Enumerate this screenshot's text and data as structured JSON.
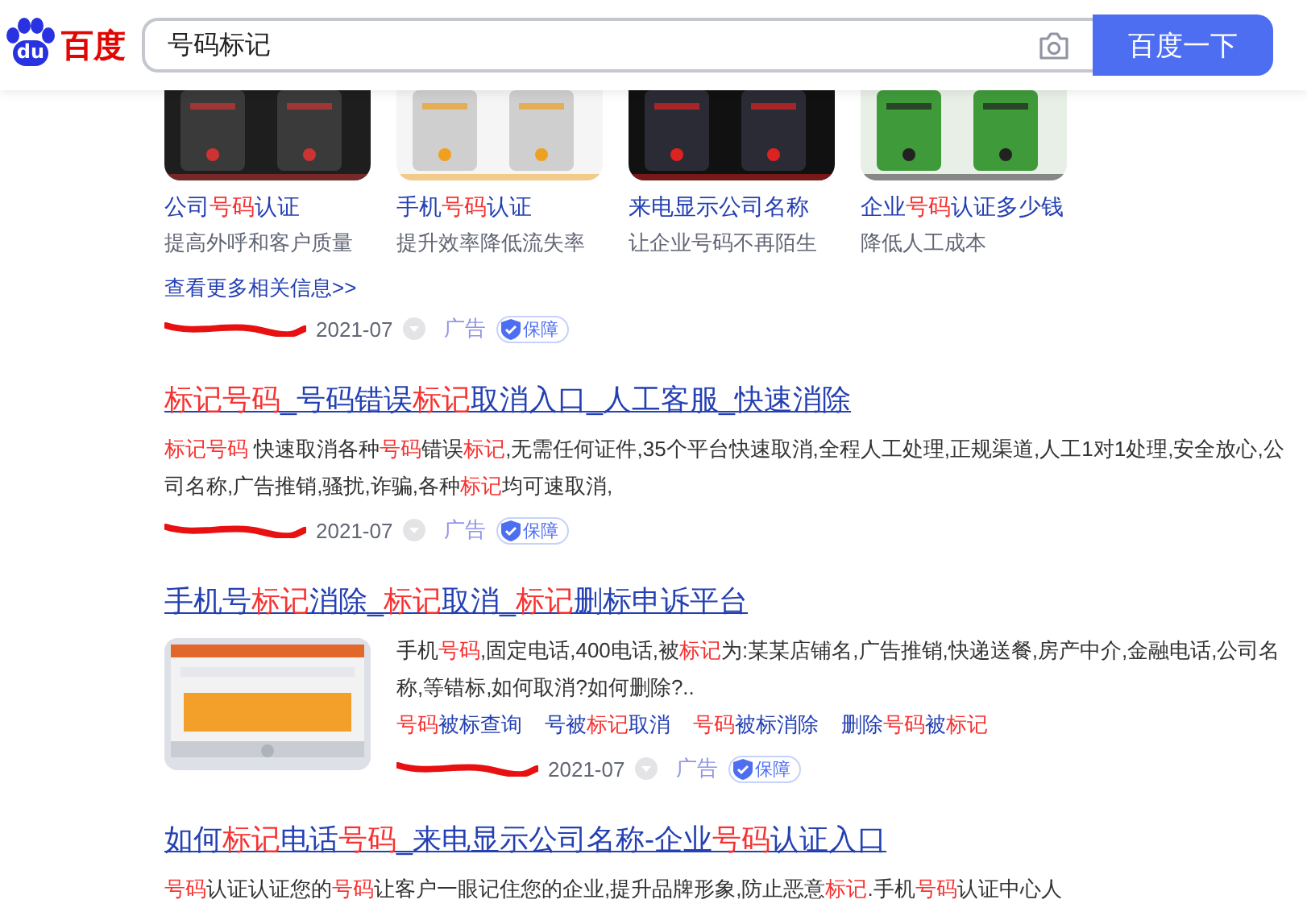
{
  "header": {
    "logo_mark": "du",
    "logo_text": "百度",
    "search": {
      "value": "号码标记",
      "button": "百度一下"
    }
  },
  "ad_cards": {
    "cards": [
      {
        "title": [
          {
            "t": "公司"
          },
          {
            "t": "号码",
            "hit": true
          },
          {
            "t": "认证"
          }
        ],
        "subtitle": "提高外呼和客户质量",
        "picture": {
          "kind": "picture"
        }
      },
      {
        "title": [
          {
            "t": "手机"
          },
          {
            "t": "号码",
            "hit": true
          },
          {
            "t": "认证"
          }
        ],
        "subtitle": "提升效率降低流失率",
        "picture": {
          "kind": "picture"
        }
      },
      {
        "title": [
          {
            "t": "来电显示公司名称"
          }
        ],
        "subtitle": "让企业号码不再陌生",
        "picture": {
          "kind": "picture"
        }
      },
      {
        "title": [
          {
            "t": "企业"
          },
          {
            "t": "号码",
            "hit": true
          },
          {
            "t": "认证多少钱"
          }
        ],
        "subtitle": "降低人工成本",
        "picture": {
          "kind": "picture"
        }
      }
    ],
    "more_link": "查看更多相关信息>>",
    "source": {
      "date": "2021-07",
      "ad_label": "广告",
      "badge": "保障"
    }
  },
  "results": [
    {
      "title": [
        {
          "t": "标记号码",
          "hit": true
        },
        {
          "t": "_号码错误"
        },
        {
          "t": "标记",
          "hit": true
        },
        {
          "t": "取消入口_人工客服_快速消除"
        }
      ],
      "description": [
        {
          "t": "标记号码",
          "hit": true
        },
        {
          "t": " 快速取消各种"
        },
        {
          "t": "号码",
          "hit": true
        },
        {
          "t": "错误"
        },
        {
          "t": "标记",
          "hit": true
        },
        {
          "t": ",无需任何证件,35个平台快速取消,全程人工处理,正规渠道,人工1对1处理,安全放心,公司名称,广告推销,骚扰,诈骗,各种"
        },
        {
          "t": "标记",
          "hit": true
        },
        {
          "t": "均可速取消,"
        }
      ],
      "source": {
        "date": "2021-07",
        "ad_label": "广告",
        "badge": "保障"
      }
    },
    {
      "title": [
        {
          "t": "手机号"
        },
        {
          "t": "标记",
          "hit": true
        },
        {
          "t": "消除_"
        },
        {
          "t": "标记",
          "hit": true
        },
        {
          "t": "取消_"
        },
        {
          "t": "标记",
          "hit": true
        },
        {
          "t": "删标申诉平台"
        }
      ],
      "thumbnail": {
        "kind": "picture"
      },
      "description": [
        {
          "t": "手机"
        },
        {
          "t": "号码",
          "hit": true
        },
        {
          "t": ",固定电话,400电话,被"
        },
        {
          "t": "标记",
          "hit": true
        },
        {
          "t": "为:某某店铺名,广告推销,快递送餐,房产中介,金融电话,公司名称,等错标,如何取消?如何删除?.."
        }
      ],
      "sublinks": [
        [
          {
            "t": "号码",
            "hit": true
          },
          {
            "t": "被标查询"
          }
        ],
        [
          {
            "t": "号被"
          },
          {
            "t": "标记",
            "hit": true
          },
          {
            "t": "取消"
          }
        ],
        [
          {
            "t": "号码",
            "hit": true
          },
          {
            "t": "被标消除"
          }
        ],
        [
          {
            "t": "删除"
          },
          {
            "t": "号码",
            "hit": true
          },
          {
            "t": "被"
          },
          {
            "t": "标记",
            "hit": true
          }
        ]
      ],
      "source": {
        "date": "2021-07",
        "ad_label": "广告",
        "badge": "保障"
      }
    },
    {
      "title": [
        {
          "t": "如何"
        },
        {
          "t": "标记",
          "hit": true
        },
        {
          "t": "电话"
        },
        {
          "t": "号码",
          "hit": true
        },
        {
          "t": "_来电显示公司名称-企业"
        },
        {
          "t": "号码",
          "hit": true
        },
        {
          "t": "认证入口"
        }
      ],
      "description": [
        {
          "t": "号码",
          "hit": true
        },
        {
          "t": "认证认证您的"
        },
        {
          "t": "号码",
          "hit": true
        },
        {
          "t": "让客户一眼记住您的企业,提升品牌形象,防止恶意"
        },
        {
          "t": "标记",
          "hit": true
        },
        {
          "t": ".手机"
        },
        {
          "t": "号码",
          "hit": true
        },
        {
          "t": "认证中心人"
        }
      ]
    }
  ]
}
